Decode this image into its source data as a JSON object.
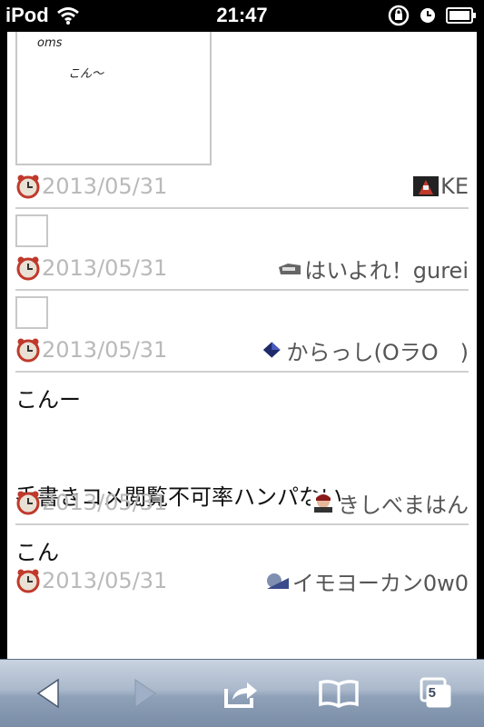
{
  "status_bar": {
    "carrier": "iPod",
    "time": "21:47"
  },
  "entries": [
    {
      "date": "2013/05/31",
      "author": "KE",
      "sketch_lines": [
        "oms",
        "こん〜"
      ]
    },
    {
      "date": "2013/05/31",
      "author": "はいよれ！gurei"
    },
    {
      "date": "2013/05/31",
      "author": "からっし(OラO　)"
    },
    {
      "comment_lines": [
        "こんー",
        "手書きコメ閲覧不可率ハンパない"
      ],
      "date": "2013/05/31",
      "author": "きしべまはん"
    },
    {
      "comment_lines": [
        "こん"
      ],
      "date": "2013/05/31",
      "author": "イモヨーカン0w0"
    }
  ],
  "toolbar": {
    "tab_count": "5"
  },
  "colors": {
    "date_gray": "#b9b9b9",
    "divider": "#cfcfcf",
    "toolbar": "#9eafc4"
  }
}
